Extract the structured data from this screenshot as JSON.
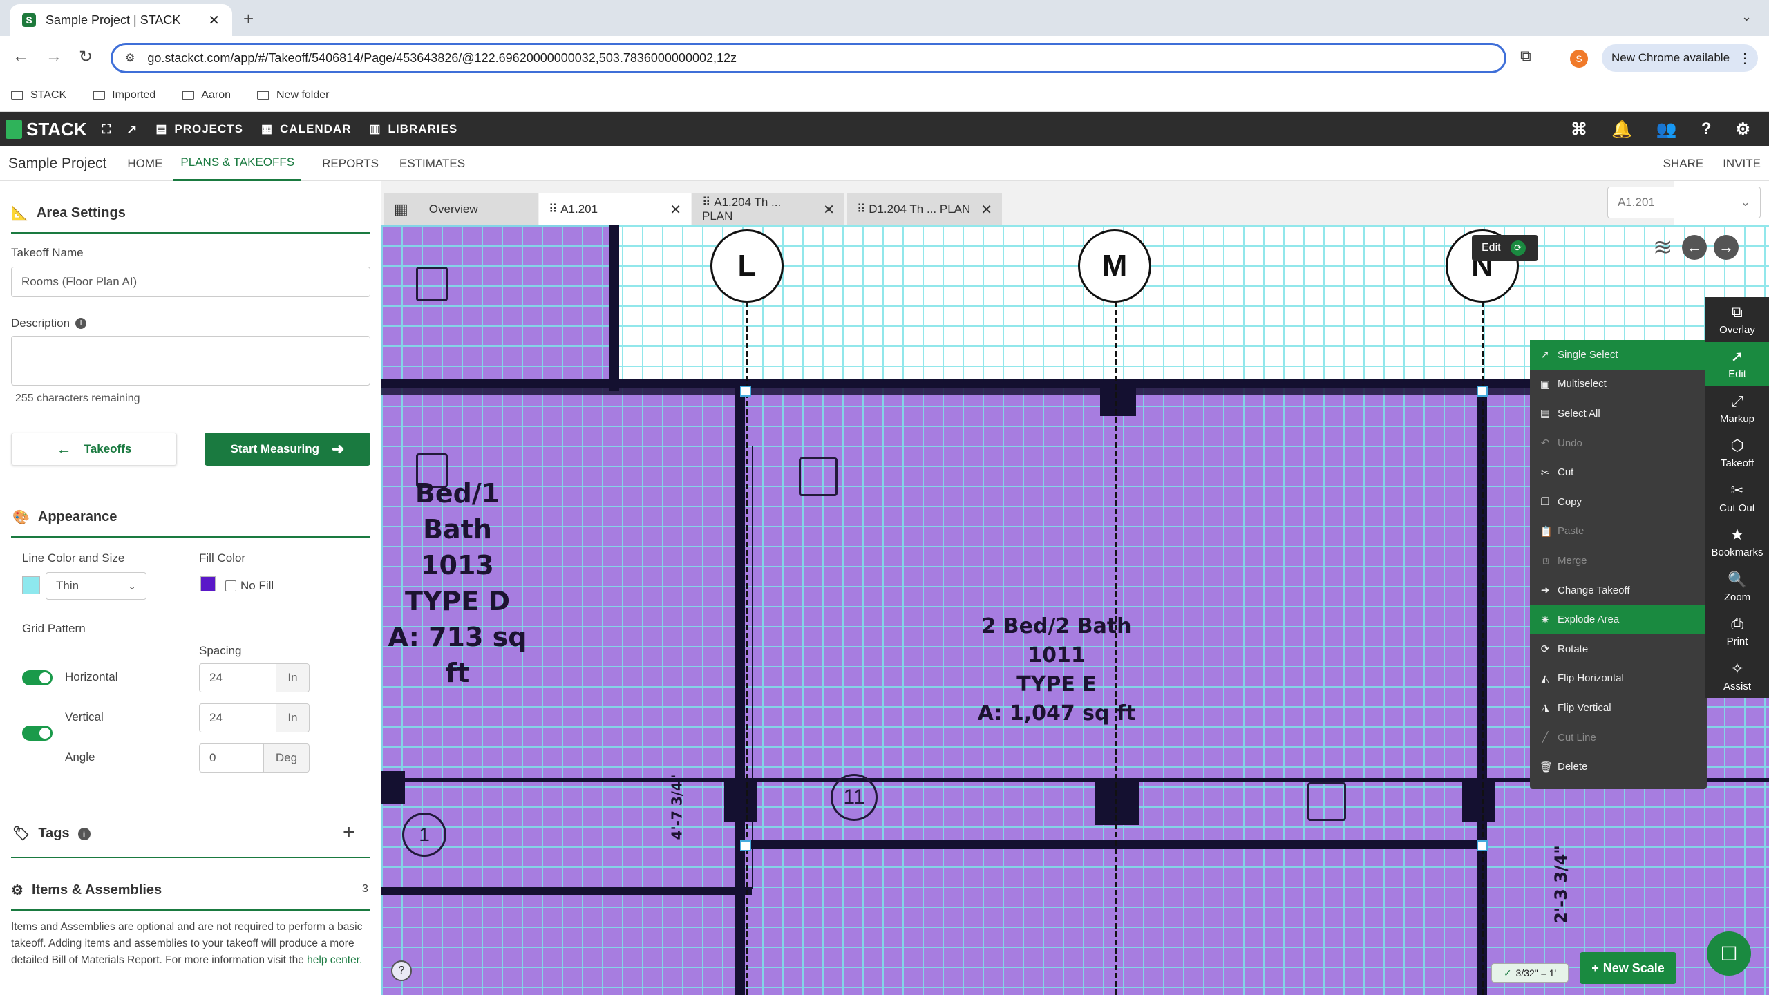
{
  "browser": {
    "tab_title": "Sample Project | STACK",
    "favicon_letter": "S",
    "url": "go.stackct.com/app/#/Takeoff/5406814/Page/453643826/@122.69620000000032,503.7836000000002,12z",
    "profile_letter": "S",
    "new_chrome": "New Chrome available",
    "bookmarks": [
      "STACK",
      "Imported",
      "Aaron",
      "New folder"
    ]
  },
  "app": {
    "logo": "STACK",
    "nav": [
      "PROJECTS",
      "CALENDAR",
      "LIBRARIES"
    ],
    "project_name": "Sample Project",
    "subnav": [
      "HOME",
      "PLANS & TAKEOFFS",
      "REPORTS",
      "ESTIMATES"
    ],
    "share": "SHARE",
    "invite": "INVITE"
  },
  "panel": {
    "title": "Area Settings",
    "takeoff_name_label": "Takeoff Name",
    "takeoff_name_value": "Rooms (Floor Plan AI)",
    "description_label": "Description",
    "chars_remaining": "255 characters remaining",
    "takeoffs_btn": "Takeoffs",
    "start_btn": "Start Measuring",
    "appearance": "Appearance",
    "line_color_label": "Line Color and Size",
    "line_size": "Thin",
    "fill_color_label": "Fill Color",
    "no_fill": "No Fill",
    "grid_pattern": "Grid Pattern",
    "spacing": "Spacing",
    "horizontal": "Horizontal",
    "vertical": "Vertical",
    "angle": "Angle",
    "h_value": "24",
    "v_value": "24",
    "angle_value": "0",
    "unit_in": "In",
    "unit_deg": "Deg",
    "tags": "Tags",
    "items_title": "Items & Assemblies",
    "items_count": "3",
    "items_text": "Items and Assemblies are optional and are not required to perform a basic takeoff. Adding items and assemblies to your takeoff will produce a more detailed Bill of Materials Report. For more information visit the",
    "help_link": "help center."
  },
  "doc_tabs": {
    "overview": "Overview",
    "tabs": [
      "A1.201",
      "A1.204 Th ... PLAN",
      "D1.204 Th ... PLAN"
    ],
    "page_select": "A1.201"
  },
  "drawing": {
    "bubbles": [
      "L",
      "M",
      "N"
    ],
    "room1": [
      "Bed/1 Bath",
      "1013",
      "TYPE D",
      "A: 713 sq ft"
    ],
    "room2": [
      "2 Bed/2 Bath",
      "1011",
      "TYPE E",
      "A: 1,047 sq ft"
    ],
    "dim1": "4'-7 3/4\"",
    "dim2": "2'-3 3/4\"",
    "tag11": "11",
    "tag1": "1",
    "edit_tip": "Edit",
    "scale": "3/32\" = 1'",
    "new_scale": "New Scale"
  },
  "context_menu": [
    {
      "label": "Single Select",
      "icon": "➚",
      "state": "highlight"
    },
    {
      "label": "Multiselect",
      "icon": "▣",
      "state": ""
    },
    {
      "label": "Select All",
      "icon": "▤",
      "state": ""
    },
    {
      "label": "Undo",
      "icon": "↶",
      "state": "disabled"
    },
    {
      "label": "Cut",
      "icon": "✂",
      "state": ""
    },
    {
      "label": "Copy",
      "icon": "❐",
      "state": ""
    },
    {
      "label": "Paste",
      "icon": "📋",
      "state": "disabled"
    },
    {
      "label": "Merge",
      "icon": "⧉",
      "state": "disabled"
    },
    {
      "label": "Change Takeoff",
      "icon": "➜",
      "state": ""
    },
    {
      "label": "Explode Area",
      "icon": "✷",
      "state": "highlight"
    },
    {
      "label": "Rotate",
      "icon": "⟳",
      "state": ""
    },
    {
      "label": "Flip Horizontal",
      "icon": "◭",
      "state": ""
    },
    {
      "label": "Flip Vertical",
      "icon": "◮",
      "state": ""
    },
    {
      "label": "Cut Line",
      "icon": "╱",
      "state": "disabled"
    },
    {
      "label": "Delete",
      "icon": "🗑",
      "state": ""
    }
  ],
  "right_tools": [
    {
      "label": "Overlay",
      "icon": "⧉"
    },
    {
      "label": "Edit",
      "icon": "➚"
    },
    {
      "label": "Markup",
      "icon": "⤢"
    },
    {
      "label": "Takeoff",
      "icon": "⬡"
    },
    {
      "label": "Cut Out",
      "icon": "✂"
    },
    {
      "label": "Bookmarks",
      "icon": "★"
    },
    {
      "label": "Zoom",
      "icon": "🔍"
    },
    {
      "label": "Print",
      "icon": "⎙"
    },
    {
      "label": "Assist",
      "icon": "✧"
    }
  ],
  "colors": {
    "accent": "#1a7a40",
    "area_fill": "#a77de0",
    "grid_line": "#7fe3e8",
    "line_swatch": "#8ee8ee",
    "fill_swatch": "#5a18c8"
  }
}
